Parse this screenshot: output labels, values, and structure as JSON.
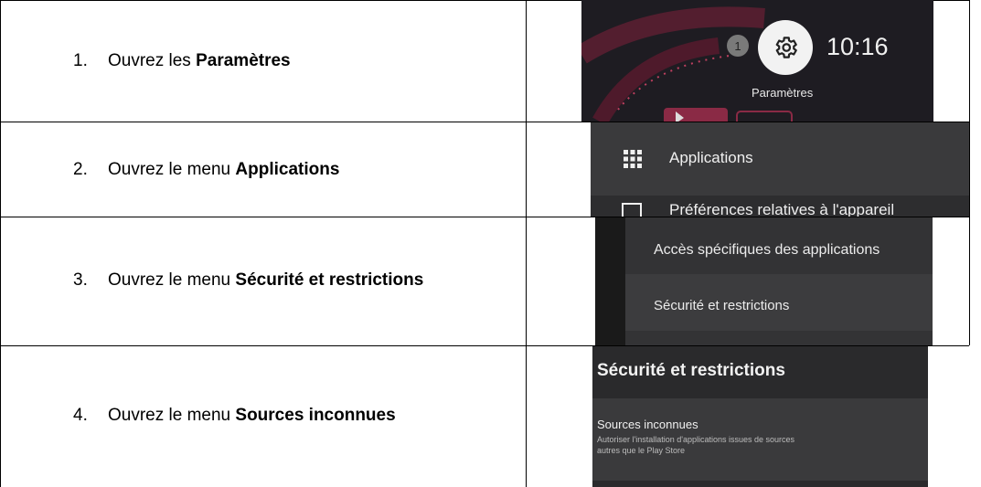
{
  "steps": [
    {
      "num": "1.",
      "text": "Ouvrez les",
      "bold": "Paramètres"
    },
    {
      "num": "2.",
      "text": "Ouvrez le menu",
      "bold": "Applications"
    },
    {
      "num": "3.",
      "text": "Ouvrez le menu",
      "bold": "Sécurité et restrictions"
    },
    {
      "num": "4.",
      "text": "Ouvrez le menu",
      "bold": "Sources inconnues"
    }
  ],
  "shot1": {
    "badge": "1",
    "time": "10:16",
    "label": "Paramètres",
    "icon": "gear-icon"
  },
  "shot2": {
    "item1": "Applications",
    "item2": "Préférences relatives à l'appareil",
    "icon1": "grid-icon",
    "icon2": "square-icon"
  },
  "shot3": {
    "item1": "Accès spécifiques des applications",
    "item2": "Sécurité et restrictions"
  },
  "shot4": {
    "title": "Sécurité et restrictions",
    "item_title": "Sources inconnues",
    "item_desc_1": "Autoriser l'installation d'applications issues de sources",
    "item_desc_2": "autres que le Play Store"
  },
  "colors": {
    "tv_bg": "#2d2d2f",
    "tv_accent": "#8a2a45",
    "text_light": "#e8e8e8"
  }
}
